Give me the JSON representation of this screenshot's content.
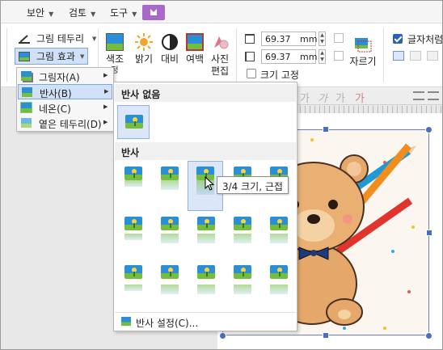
{
  "menubar": {
    "security": "보안",
    "review": "검토",
    "tools": "도구"
  },
  "ribbon": {
    "picture_border": "그림 테두리",
    "picture_effects": "그림 효과",
    "color_adjust": "색조",
    "color_adjust_2": "정",
    "brightness": "밝기",
    "contrast": "대비",
    "margin": "여백",
    "photo_edit_1": "사진",
    "photo_edit_2": "편집",
    "width_value": "69.37",
    "height_value": "69.37",
    "unit": "mm",
    "lock_size": "크기 고정",
    "crop": "자르기",
    "text_wrap": "글자처럼"
  },
  "effect_menu": {
    "items": [
      {
        "label": "그림자(A)",
        "active": false
      },
      {
        "label": "반사(B)",
        "active": true
      },
      {
        "label": "네온(C)",
        "active": false
      },
      {
        "label": "옅은 테두리(D)",
        "active": false
      }
    ]
  },
  "reflection_menu": {
    "header_none": "반사 없음",
    "header_reflection": "반사",
    "footer": "반사 설정(C)...",
    "tooltip": "3/4 크기, 근접"
  },
  "colors": {
    "accent": "#4a6fc1",
    "highlight": "#cfe0f7",
    "addin": "#a869c8"
  }
}
